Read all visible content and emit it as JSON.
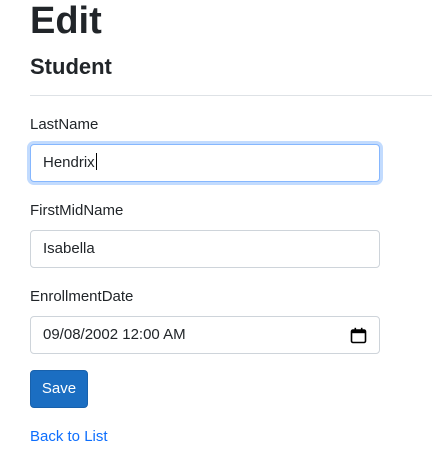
{
  "page": {
    "title": "Edit",
    "entity": "Student"
  },
  "form": {
    "last_name": {
      "label": "LastName",
      "value": "Hendrix"
    },
    "first_mid_name": {
      "label": "FirstMidName",
      "value": "Isabella"
    },
    "enrollment_date": {
      "label": "EnrollmentDate",
      "value": "09/08/2002 12:00 AM",
      "icon": "calendar-icon"
    },
    "save_label": "Save"
  },
  "nav": {
    "back_label": "Back to List"
  },
  "colors": {
    "primary": "#1b6ec2",
    "link": "#0d6efd",
    "focus_border": "#86b7fe",
    "input_border": "#ced4da"
  }
}
